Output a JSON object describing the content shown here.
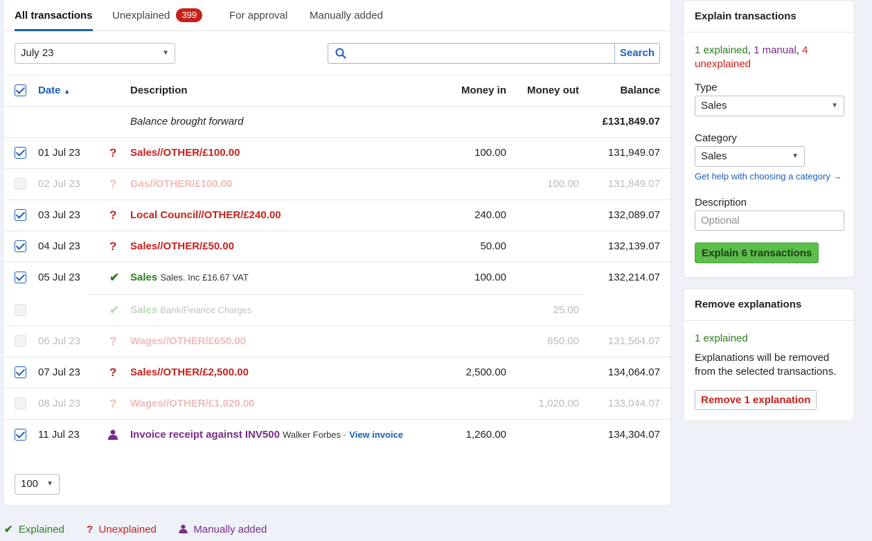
{
  "tabs": {
    "all": "All transactions",
    "unexplained": "Unexplained",
    "unexplained_count": "399",
    "for_approval": "For approval",
    "manually_added": "Manually added"
  },
  "toolbar": {
    "month": "July 23",
    "search_placeholder": "",
    "search_button": "Search"
  },
  "table": {
    "headers": {
      "date": "Date",
      "description": "Description",
      "money_in": "Money in",
      "money_out": "Money out",
      "balance": "Balance"
    },
    "brought_forward": {
      "label": "Balance brought forward",
      "balance": "£131,849.07"
    },
    "rows": [
      {
        "date": "01 Jul 23",
        "status": "?",
        "desc": "Sales//OTHER/£100.00",
        "in": "100.00",
        "out": "",
        "balance": "131,949.07"
      },
      {
        "date": "02 Jul 23",
        "status": "?",
        "desc": "Gas//OTHER/£100.00",
        "in": "",
        "out": "100.00",
        "balance": "131,849.07"
      },
      {
        "date": "03 Jul 23",
        "status": "?",
        "desc": "Local Council//OTHER/£240.00",
        "in": "240.00",
        "out": "",
        "balance": "132,089.07"
      },
      {
        "date": "04 Jul 23",
        "status": "?",
        "desc": "Sales//OTHER/£50.00",
        "in": "50.00",
        "out": "",
        "balance": "132,139.07"
      },
      {
        "date": "05 Jul 23",
        "status": "✔",
        "desc": "Sales",
        "sub": "Sales. Inc £16.67 VAT",
        "in": "100.00",
        "out": "",
        "balance": "132,214.07"
      },
      {
        "date": "",
        "status": "✔",
        "desc": "Sales",
        "sub": "Bank/Finance Charges",
        "in": "",
        "out": "25.00",
        "balance": ""
      },
      {
        "date": "06 Jul 23",
        "status": "?",
        "desc": "Wages//OTHER/£650.00",
        "in": "",
        "out": "650.00",
        "balance": "131,564.07"
      },
      {
        "date": "07 Jul 23",
        "status": "?",
        "desc": "Sales//OTHER/£2,500.00",
        "in": "2,500.00",
        "out": "",
        "balance": "134,064.07"
      },
      {
        "date": "08 Jul 23",
        "status": "?",
        "desc": "Wages//OTHER/£1,020.00",
        "in": "",
        "out": "1,020.00",
        "balance": "133,044.07"
      },
      {
        "date": "11 Jul 23",
        "status": "person",
        "desc": "Invoice receipt against INV500",
        "sub": "Walker Forbes ·",
        "link": "View invoice",
        "in": "1,260.00",
        "out": "",
        "balance": "134,304.07"
      }
    ]
  },
  "pagination": {
    "page_size": "100"
  },
  "legend": {
    "explained": "Explained",
    "unexplained": "Unexplained",
    "manual": "Manually added"
  },
  "explain_card": {
    "title": "Explain transactions",
    "summary_explained": "1 explained",
    "summary_sep1": ",",
    "summary_manual": "1 manual",
    "summary_sep2": ",",
    "summary_unexplained": "4 unexplained",
    "type_label": "Type",
    "type_value": "Sales",
    "category_label": "Category",
    "category_value": "Sales",
    "help_link": "Get help with choosing a category →",
    "description_label": "Description",
    "description_placeholder": "Optional",
    "button": "Explain 6 transactions"
  },
  "remove_card": {
    "title": "Remove explanations",
    "summary": "1 explained",
    "text": "Explanations will be removed from the selected transactions.",
    "button": "Remove 1 explanation"
  },
  "colors": {
    "accent": "#1b5fb8",
    "unexplained": "#c8211c",
    "explained": "#2f7d1f",
    "manual": "#7a2b8a",
    "button_green": "#5cbf4c"
  }
}
